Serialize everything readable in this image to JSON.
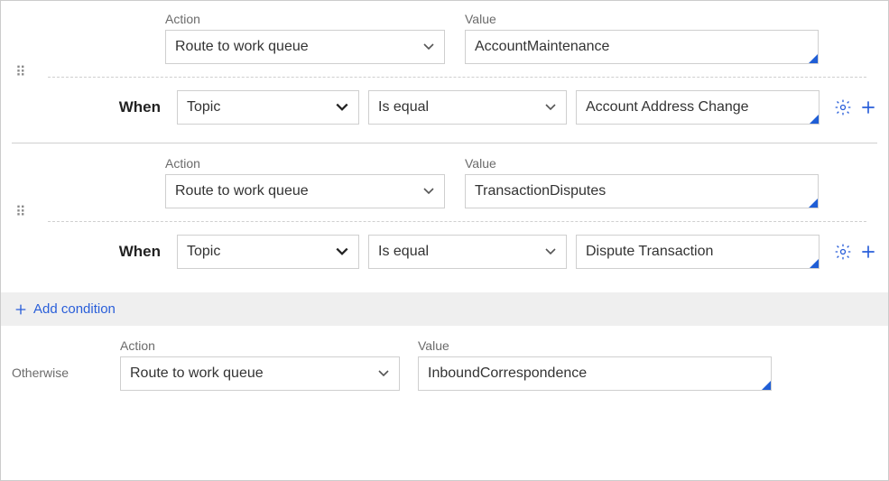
{
  "labels": {
    "action": "Action",
    "value": "Value",
    "when": "When",
    "otherwise": "Otherwise",
    "add_condition": "Add condition"
  },
  "rules": [
    {
      "action": "Route to work queue",
      "value": "AccountMaintenance",
      "when": {
        "field": "Topic",
        "operator": "Is equal",
        "operand": "Account Address Change"
      }
    },
    {
      "action": "Route to work queue",
      "value": "TransactionDisputes",
      "when": {
        "field": "Topic",
        "operator": "Is equal",
        "operand": "Dispute Transaction"
      }
    }
  ],
  "otherwise": {
    "action": "Route to work queue",
    "value": "InboundCorrespondence"
  }
}
